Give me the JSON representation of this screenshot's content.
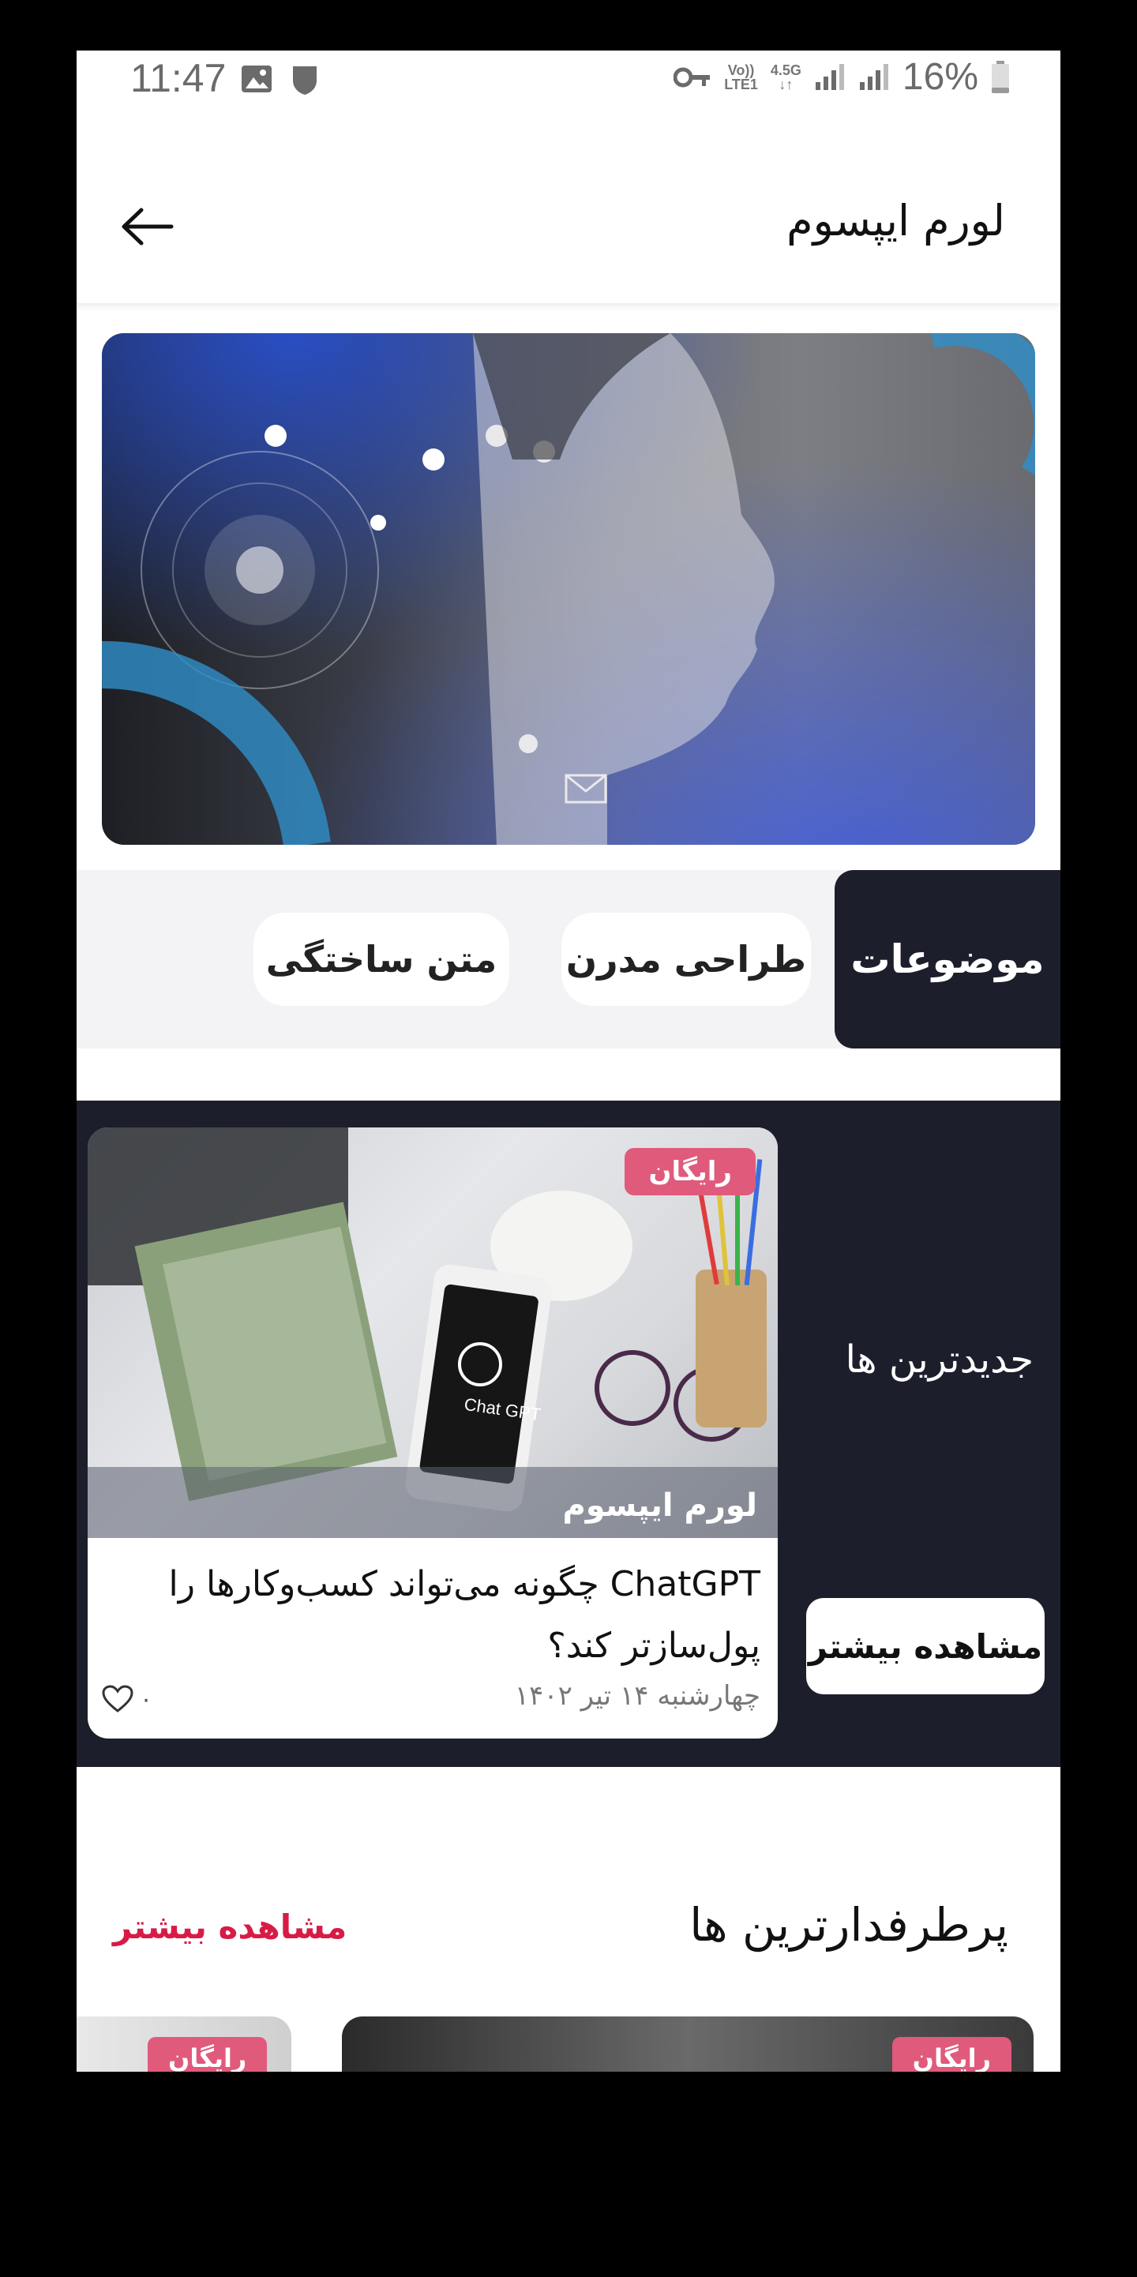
{
  "status_bar": {
    "time": "11:47",
    "network_top": "Vo))",
    "network_bottom": "LTE1",
    "speed_top": "4.5G",
    "battery": "16%"
  },
  "app_bar": {
    "title": "لورم ایپسوم",
    "back_icon": "arrow-left-icon"
  },
  "topics": {
    "label": "موضوعات",
    "chips": [
      "طراحی مدرن",
      "متن ساختگی"
    ]
  },
  "newest": {
    "title": "جدیدترین ها",
    "more_label": "مشاهده بیشتر",
    "card": {
      "badge": "رایگان",
      "category": "لورم ایپسوم",
      "title": "ChatGPT چگونه می‌تواند کسب‌وکارها را پول‌سازتر کند؟",
      "date": "چهارشنبه ۱۴ تیر ۱۴۰۲",
      "likes": "۰",
      "phone_text": "Chat GPT"
    }
  },
  "popular": {
    "title": "پرطرفدارترین ها",
    "more_label": "مشاهده بیشتر",
    "badges": [
      "رایگان",
      "رایگان"
    ]
  },
  "colors": {
    "dark": "#1c1f2b",
    "accent": "#d81b46",
    "badge": "#e05a7c"
  }
}
